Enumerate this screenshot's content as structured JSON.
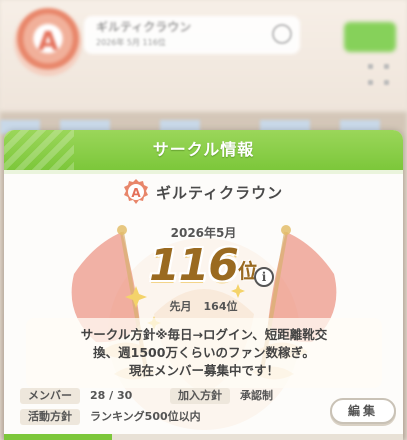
{
  "background": {
    "circle_name": "ギルティクラウン",
    "circle_sub": "2026年 5月 116位",
    "emblem_letter": "A"
  },
  "dialog": {
    "title": "サークル情報",
    "circle_name": "ギルティクラウン",
    "emblem_letter": "A",
    "month": "2026年5月",
    "rank": "116",
    "rank_unit": "位",
    "info_icon_label": "i",
    "prev_label": "先月",
    "prev_rank": "164位",
    "policy_text": "サークル方針※毎日→ログイン、短距離靴交\n換、週1500万くらいのファン数稼ぎ。\n現在メンバー募集中です！",
    "members_label": "メンバー",
    "members_value": "28 / 30",
    "join_label": "加入方針",
    "join_value": "承認制",
    "activity_label": "活動方針",
    "activity_value": "ランキング500位以内",
    "edit_label": "編集"
  },
  "progress": {
    "fraction": 0.27
  },
  "colors": {
    "header_green": "#7cc73a",
    "rank_gold": "#9a6a20",
    "flag_red": "#e8735f"
  },
  "icons": [
    "circle-emblem-icon",
    "info-icon",
    "flag-art",
    "dots-grid-icon"
  ]
}
